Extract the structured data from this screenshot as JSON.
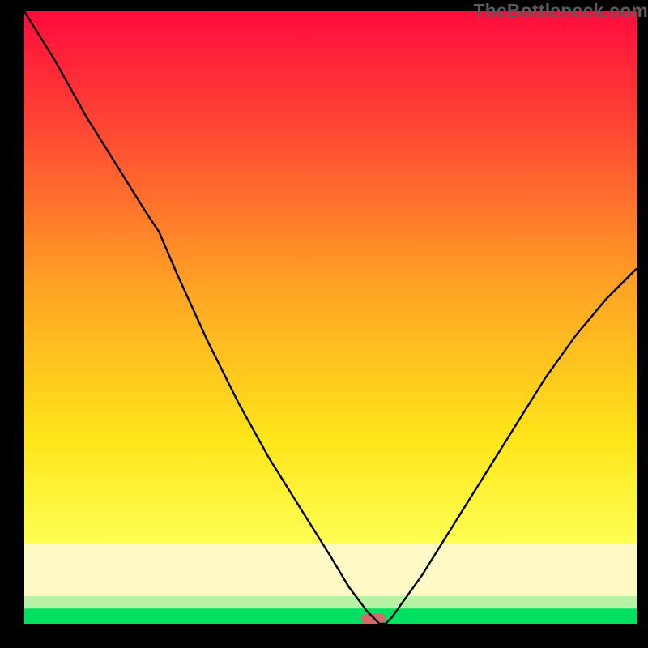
{
  "watermark": "TheBottleneck.com",
  "chart_data": {
    "type": "line",
    "title": "",
    "xlabel": "",
    "ylabel": "",
    "xlim": [
      0,
      100
    ],
    "ylim": [
      0,
      100
    ],
    "grid": false,
    "series": [
      {
        "name": "bottleneck-curve",
        "color": "#000000",
        "x": [
          0,
          5,
          10,
          15,
          20,
          22,
          25,
          30,
          35,
          40,
          45,
          50,
          53,
          56,
          57,
          58,
          59,
          60,
          65,
          70,
          75,
          80,
          85,
          90,
          95,
          100
        ],
        "y": [
          100,
          92,
          83,
          75,
          67,
          64,
          57,
          46,
          36,
          27,
          19,
          11,
          6,
          2,
          1,
          0,
          0,
          1,
          8,
          16,
          24,
          32,
          40,
          47,
          53,
          58
        ]
      }
    ],
    "bands": [
      {
        "name": "green-band",
        "color": "#00e063",
        "y0": 0,
        "y1": 2.5
      },
      {
        "name": "pale-green-band",
        "color": "#b8f2a5",
        "y0": 2.5,
        "y1": 4.5
      },
      {
        "name": "pale-yellow-band",
        "color": "#fff9c6",
        "y0": 4.5,
        "y1": 13
      }
    ],
    "gradient_stops": [
      {
        "offset": 0,
        "color": "#ff0b3c"
      },
      {
        "offset": 20,
        "color": "#ff4a33"
      },
      {
        "offset": 45,
        "color": "#ffa324"
      },
      {
        "offset": 70,
        "color": "#ffe61a"
      },
      {
        "offset": 87,
        "color": "#ffff55"
      },
      {
        "offset": 100,
        "color": "#ffffb0"
      }
    ],
    "optimum_marker": {
      "x_center": 57,
      "x_halfwidth": 2,
      "y": 0,
      "color": "#d46a6a"
    }
  }
}
